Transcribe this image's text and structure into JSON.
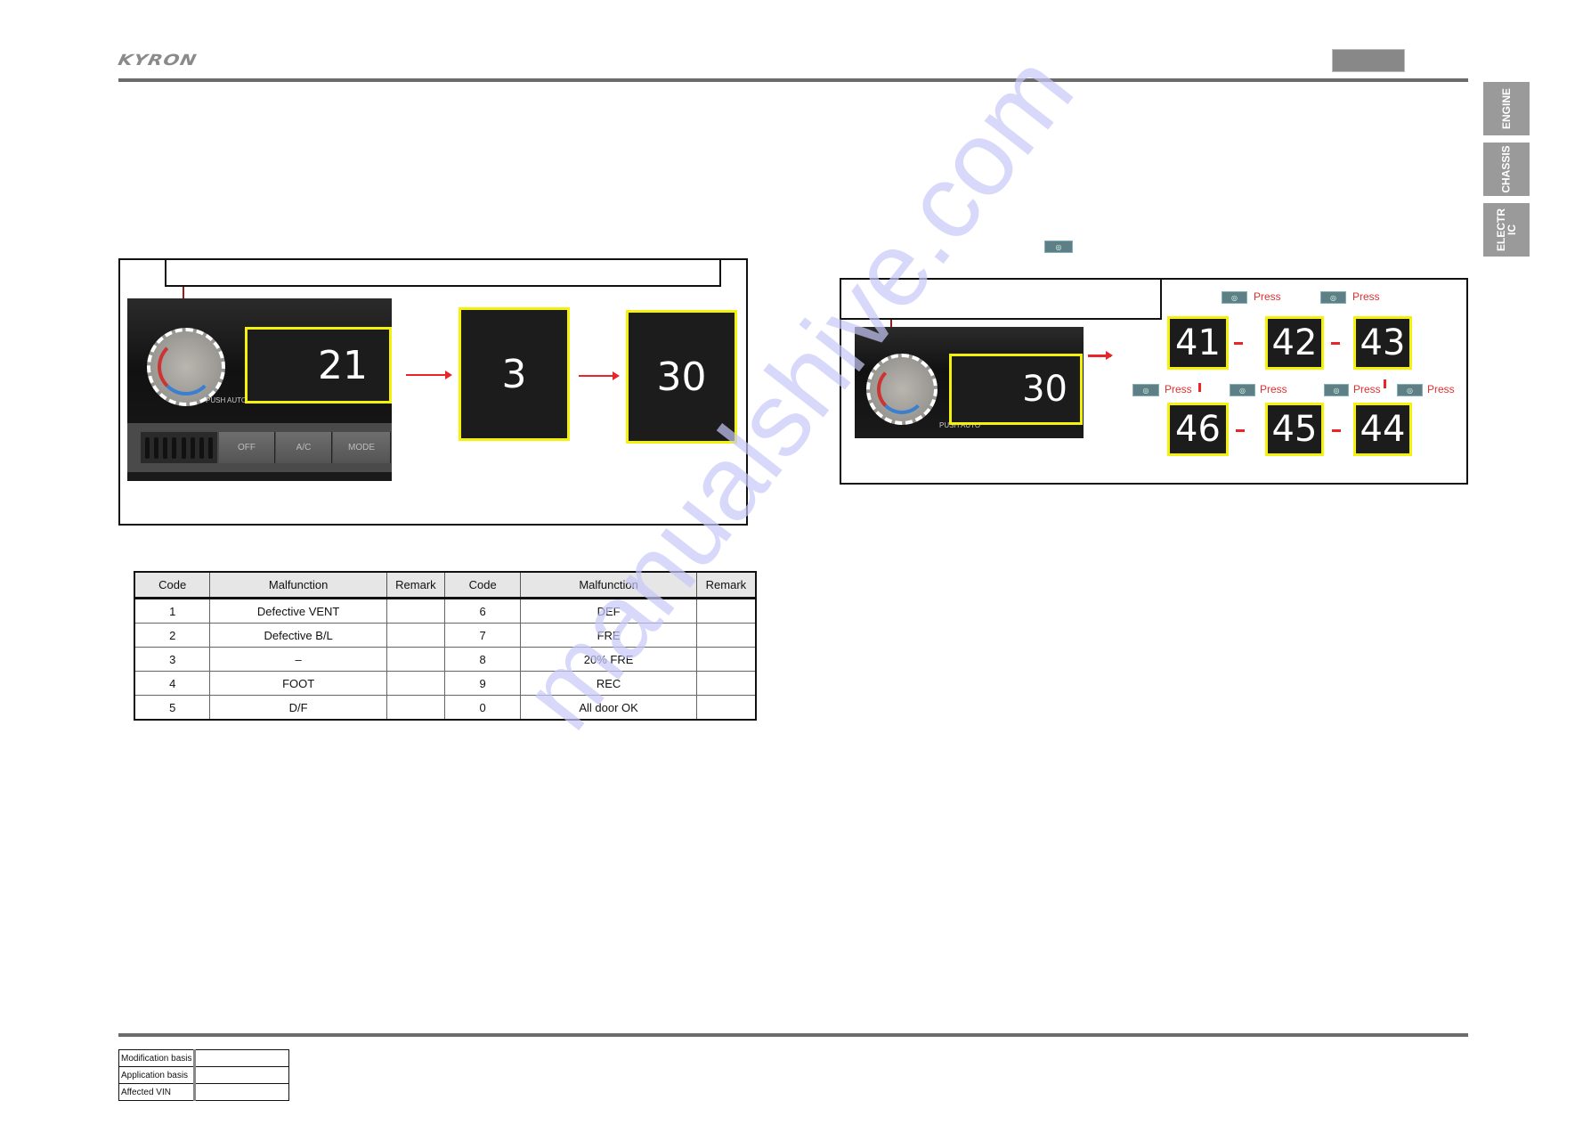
{
  "header": {
    "brand": "KYRON"
  },
  "side_tabs": [
    {
      "label": "ENGINE"
    },
    {
      "label": "CHASSIS"
    },
    {
      "label": "ELECTRIC"
    }
  ],
  "left_diagram": {
    "hvac_buttons": [
      "OFF",
      "A/C",
      "MODE"
    ],
    "knob_label": "PUSH AUTO",
    "display_start": "21",
    "steps": [
      "3",
      "30"
    ]
  },
  "right_diagram": {
    "knob_label": "PUSH AUTO",
    "display_start": "30",
    "codes_row1": [
      "41",
      "42",
      "43"
    ],
    "codes_row2": [
      "46",
      "45",
      "44"
    ],
    "press_label": "Press",
    "button_icon": "rear-wiper-icon"
  },
  "code_table": {
    "headers": [
      "Code",
      "Malfunction",
      "Remark",
      "Code",
      "Malfunction",
      "Remark"
    ],
    "rows": [
      [
        "1",
        "Defective VENT",
        "",
        "6",
        "DEF",
        ""
      ],
      [
        "2",
        "Defective B/L",
        "",
        "7",
        "FRE",
        ""
      ],
      [
        "3",
        "–",
        "",
        "8",
        "20% FRE",
        ""
      ],
      [
        "4",
        "FOOT",
        "",
        "9",
        "REC",
        ""
      ],
      [
        "5",
        "D/F",
        "",
        "0",
        "All door OK",
        ""
      ]
    ]
  },
  "footer": {
    "rows": [
      {
        "label": "Modification basis",
        "value": ""
      },
      {
        "label": "Application basis",
        "value": ""
      },
      {
        "label": "Affected VIN",
        "value": ""
      }
    ]
  },
  "watermark": "manualshive.com"
}
